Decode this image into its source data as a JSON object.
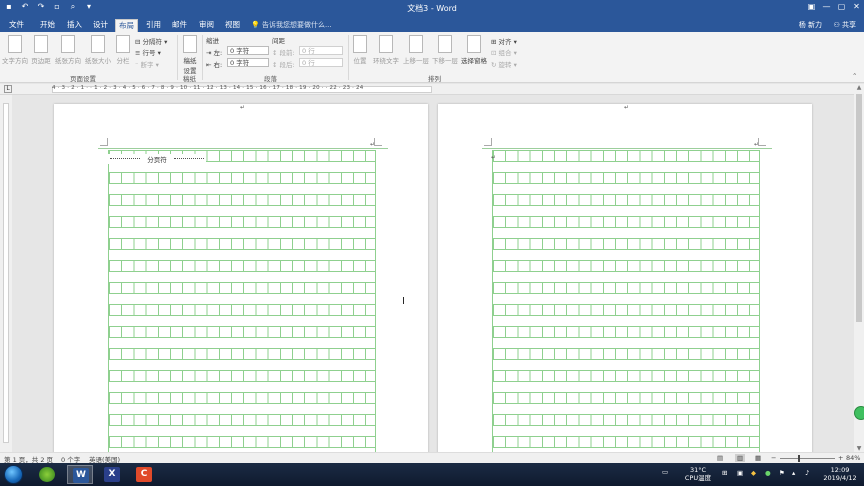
{
  "window": {
    "title": "文档3 - Word",
    "controls": [
      "restore-ribbon",
      "minimize",
      "maximize",
      "close"
    ]
  },
  "quick_access": [
    "save-icon",
    "undo-icon",
    "redo-icon",
    "new-doc-icon",
    "print-preview-icon",
    "customize-icon"
  ],
  "tabs": [
    {
      "label": "文件",
      "active": false
    },
    {
      "label": "开始",
      "active": false
    },
    {
      "label": "插入",
      "active": false
    },
    {
      "label": "设计",
      "active": false
    },
    {
      "label": "布局",
      "active": true
    },
    {
      "label": "引用",
      "active": false
    },
    {
      "label": "邮件",
      "active": false
    },
    {
      "label": "审阅",
      "active": false
    },
    {
      "label": "视图",
      "active": false
    }
  ],
  "tell_me": "告诉我您想要做什么...",
  "user": "杨 新力",
  "share": "共享",
  "ribbon": {
    "page_setup": {
      "label": "页面设置",
      "buttons": [
        "文字方向",
        "页边距",
        "纸张方向",
        "纸张大小",
        "分栏"
      ],
      "small": [
        "分隔符",
        "行号",
        "断字"
      ]
    },
    "manuscript": {
      "label": "稿纸",
      "button": "稿纸\n设置"
    },
    "paragraph": {
      "label": "段落",
      "indent_title": "缩进",
      "spacing_title": "间距",
      "indent_left_label": "左:",
      "indent_left_value": "0 字符",
      "indent_right_label": "右:",
      "indent_right_value": "0 字符",
      "space_before_label": "段前:",
      "space_before_value": "0 行",
      "space_after_label": "段后:",
      "space_after_value": "0 行"
    },
    "arrange": {
      "label": "排列",
      "buttons": [
        "位置",
        "环绕文字",
        "上移一层",
        "下移一层",
        "选择窗格"
      ],
      "small": [
        "对齐",
        "组合",
        "旋转"
      ]
    }
  },
  "ruler": {
    "numbers": "4 · 3 · 2 · 1 ·  · 1 · 2 · 3 · 4 · 5 · 6 · 7 · 8 · 9 · 10 · 11 · 12 · 13 · 14 · 15 · 16 · 17 · 18 · 19 · 20 ·  · 22 · 23 · 24"
  },
  "document": {
    "page_break_label": "分页符"
  },
  "status": {
    "page": "第 1 页，共 2 页",
    "words": "0 个字",
    "language": "英语(美国)",
    "zoom": "84%"
  },
  "taskbar": {
    "apps": [
      "windows-start",
      "browser",
      "word",
      "app-x",
      "app-c"
    ],
    "temperature": "31°C",
    "temp_label": "CPU温度",
    "time": "12:09",
    "date": "2019/4/12",
    "colors": {
      "word": "#2b579a",
      "accent": "#2b579a",
      "grid": "#8fd08f"
    }
  }
}
